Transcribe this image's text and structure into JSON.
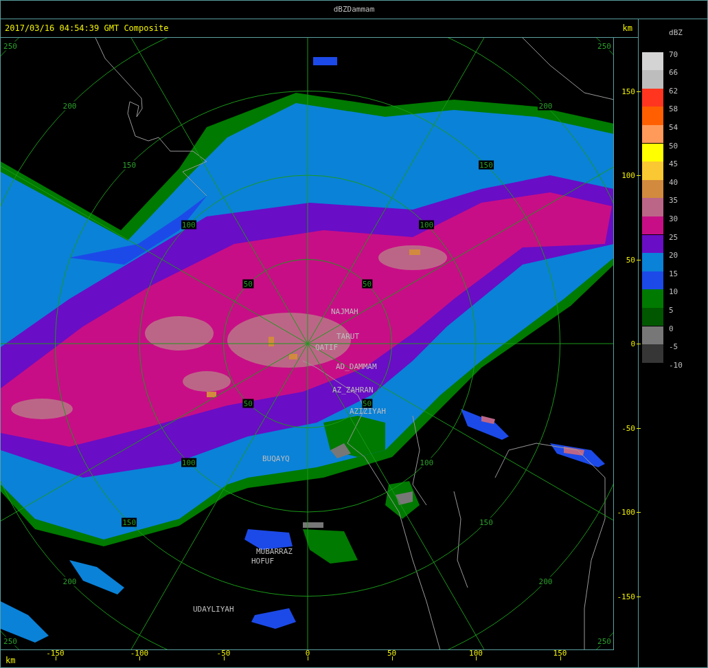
{
  "window": {
    "title": "dBZDammam"
  },
  "header": {
    "timestamp": "2017/03/16 04:54:39 GMT Composite",
    "unit": "km"
  },
  "map": {
    "range_rings": [
      {
        "labels": [
          "50",
          "50",
          "50",
          "50"
        ]
      },
      {
        "labels": [
          "100",
          "100",
          "100",
          "100"
        ]
      },
      {
        "labels": [
          "150",
          "150",
          "150",
          "150"
        ]
      },
      {
        "labels": [
          "200",
          "200",
          "200",
          "200"
        ]
      },
      {
        "labels": [
          "250",
          "250",
          "250",
          "250"
        ]
      }
    ],
    "places": [
      {
        "name": "NAJMAH"
      },
      {
        "name": "TARUT"
      },
      {
        "name": "QATIF"
      },
      {
        "name": "AD_DAMMAM"
      },
      {
        "name": "AZ_ZAHRAN"
      },
      {
        "name": "AZIZIYAH"
      },
      {
        "name": "BUQAYQ"
      },
      {
        "name": "MUBARRAZ"
      },
      {
        "name": "HOFUF"
      },
      {
        "name": "UDAYLIYAH"
      }
    ]
  },
  "y_axis": {
    "ticks": [
      "150",
      "100",
      "50",
      "0",
      "-50",
      "-100",
      "-150"
    ]
  },
  "x_axis": {
    "unit": "km",
    "ticks": [
      "-150",
      "-100",
      "-50",
      "0",
      "50",
      "100",
      "150"
    ]
  },
  "legend": {
    "title": "dBZ",
    "bins": [
      {
        "color": "#d4d4d4"
      },
      {
        "color": "#bdbdbd"
      },
      {
        "color": "#ff3520"
      },
      {
        "color": "#ff5f00"
      },
      {
        "color": "#ff9a5a"
      },
      {
        "color": "#ffff00"
      },
      {
        "color": "#fac832"
      },
      {
        "color": "#d28a3e"
      },
      {
        "color": "#bc6687"
      },
      {
        "color": "#c80e86"
      },
      {
        "color": "#6a0dc6"
      },
      {
        "color": "#0a82d8"
      },
      {
        "color": "#1c4ae8"
      },
      {
        "color": "#007a00"
      },
      {
        "color": "#005700"
      },
      {
        "color": "#777777"
      },
      {
        "color": "#363636"
      }
    ],
    "labels": [
      "70",
      "66",
      "62",
      "58",
      "54",
      "50",
      "45",
      "40",
      "35",
      "30",
      "25",
      "20",
      "15",
      "10",
      "5",
      "0",
      "-5",
      "-10"
    ]
  }
}
